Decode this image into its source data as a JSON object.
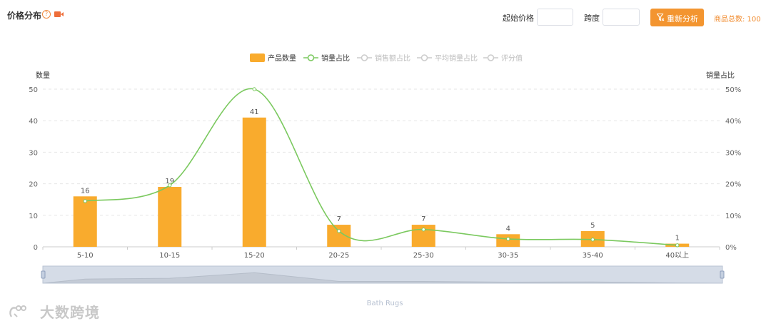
{
  "header": {
    "title": "价格分布",
    "start_price_label": "起始价格",
    "start_price_value": "",
    "span_label": "跨度",
    "span_value": "",
    "reanalyze_label": "重新分析",
    "total_label": "商品总数: 100"
  },
  "icons": {
    "help": "question-circle-icon",
    "video": "video-camera-icon",
    "filter": "filter-icon"
  },
  "colors": {
    "bar": "#f9ab2d",
    "line": "#7bc95f",
    "accent": "#f39530",
    "legend_inactive": "#cccccc"
  },
  "watermark": "大数跨境",
  "chart_data": {
    "type": "bar",
    "categories": [
      "5-10",
      "10-15",
      "15-20",
      "20-25",
      "25-30",
      "30-35",
      "35-40",
      "40以上"
    ],
    "series": [
      {
        "name": "产品数量",
        "type": "bar",
        "axis": "left",
        "values": [
          16,
          19,
          41,
          7,
          7,
          4,
          5,
          1
        ]
      },
      {
        "name": "销量占比",
        "type": "line",
        "axis": "right",
        "values": [
          14.5,
          19.5,
          50,
          5,
          5.5,
          2.5,
          2.3,
          0.5
        ]
      }
    ],
    "legend": [
      {
        "name": "产品数量",
        "active": true,
        "kind": "bar"
      },
      {
        "name": "销量占比",
        "active": true,
        "kind": "line"
      },
      {
        "name": "销售额占比",
        "active": false,
        "kind": "line"
      },
      {
        "name": "平均销量占比",
        "active": false,
        "kind": "line"
      },
      {
        "name": "评分值",
        "active": false,
        "kind": "line"
      }
    ],
    "legend_position": "top-center",
    "ylabel_left": "数量",
    "ylabel_right": "销量占比",
    "ylim_left": [
      0,
      50
    ],
    "yticks_left": [
      "0",
      "10",
      "20",
      "30",
      "40",
      "50"
    ],
    "ylim_right": [
      0,
      50
    ],
    "yticks_right": [
      "0%",
      "10%",
      "20%",
      "30%",
      "40%",
      "50%"
    ],
    "grid": true,
    "data_labels": [
      "16",
      "19",
      "41",
      "7",
      "7",
      "4",
      "5",
      "1"
    ],
    "datazoom_label": "Bath Rugs"
  }
}
